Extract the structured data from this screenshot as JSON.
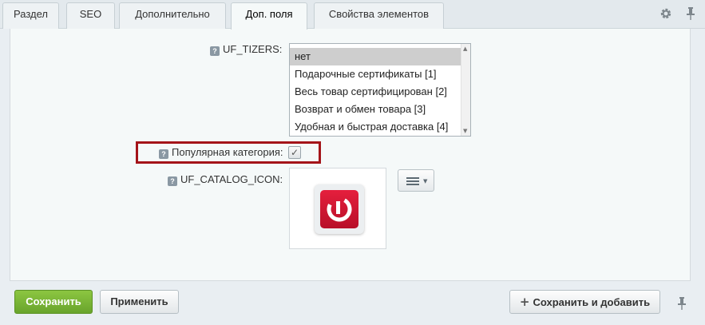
{
  "tabs": [
    {
      "label": "Раздел"
    },
    {
      "label": "SEO"
    },
    {
      "label": "Дополнительно"
    },
    {
      "label": "Доп. поля",
      "active": true
    },
    {
      "label": "Свойства элементов"
    }
  ],
  "toolbar": {
    "settings_icon": "gear-icon",
    "pin_icon": "pin-icon"
  },
  "fields": {
    "help_glyph": "?",
    "tizers": {
      "label": "UF_TIZERS:",
      "options": [
        "нет",
        "Подарочные сертификаты [1]",
        "Весь товар сертифицирован [2]",
        "Возврат и обмен товара [3]",
        "Удобная и быстрая доставка [4]"
      ],
      "selected": "нет"
    },
    "popular": {
      "label": "Популярная категория:",
      "checked": true,
      "check_glyph": "✓"
    },
    "catalog_icon": {
      "label": "UF_CATALOG_ICON:",
      "image_icon": "red-app-logo-icon"
    }
  },
  "footer": {
    "save_label": "Сохранить",
    "apply_label": "Применить",
    "save_add_label": "Сохранить и добавить",
    "plus_glyph": "+"
  },
  "colors": {
    "accent_green": "#7ab637",
    "highlight_red": "#a41419",
    "logo_red": "#d81a35"
  }
}
